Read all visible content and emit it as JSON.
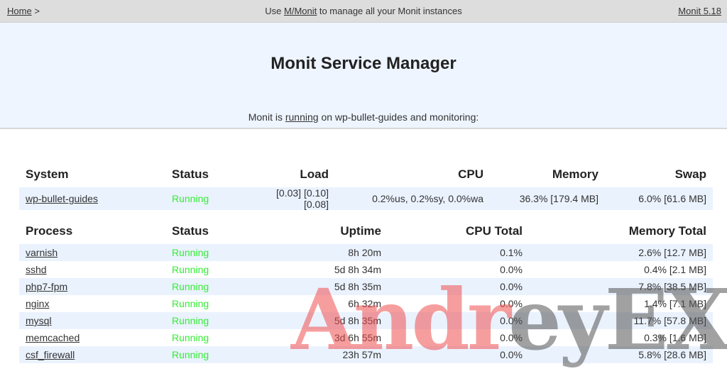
{
  "topbar": {
    "home_link": "Home",
    "home_separator": ">",
    "promo_prefix": "Use ",
    "promo_link": "M/Monit",
    "promo_suffix": " to manage all your Monit instances",
    "version_link": "Monit 5.18"
  },
  "hero": {
    "title": "Monit Service Manager",
    "subtitle_prefix": "Monit is ",
    "subtitle_link": "running",
    "subtitle_suffix": " on wp-bullet-guides and monitoring:"
  },
  "system_table": {
    "headers": [
      "System",
      "Status",
      "Load",
      "CPU",
      "Memory",
      "Swap"
    ],
    "rows": [
      {
        "name": "wp-bullet-guides",
        "status": "Running",
        "load": "[0.03] [0.10] [0.08]",
        "cpu": "0.2%us, 0.2%sy, 0.0%wa",
        "memory": "36.3% [179.4 MB]",
        "swap": "6.0% [61.6 MB]"
      }
    ]
  },
  "process_table": {
    "headers": [
      "Process",
      "Status",
      "Uptime",
      "CPU Total",
      "Memory Total"
    ],
    "rows": [
      {
        "name": "varnish",
        "status": "Running",
        "uptime": "8h 20m",
        "cpu_total": "0.1%",
        "memory_total": "2.6% [12.7 MB]"
      },
      {
        "name": "sshd",
        "status": "Running",
        "uptime": "5d 8h 34m",
        "cpu_total": "0.0%",
        "memory_total": "0.4% [2.1 MB]"
      },
      {
        "name": "php7-fpm",
        "status": "Running",
        "uptime": "5d 8h 35m",
        "cpu_total": "0.0%",
        "memory_total": "7.8% [38.5 MB]"
      },
      {
        "name": "nginx",
        "status": "Running",
        "uptime": "6h 32m",
        "cpu_total": "0.0%",
        "memory_total": "1.4% [7.1 MB]"
      },
      {
        "name": "mysql",
        "status": "Running",
        "uptime": "5d 8h 35m",
        "cpu_total": "0.0%",
        "memory_total": "11.7% [57.8 MB]"
      },
      {
        "name": "memcached",
        "status": "Running",
        "uptime": "3d 6h 55m",
        "cpu_total": "0.0%",
        "memory_total": "0.3% [1.6 MB]"
      },
      {
        "name": "csf_firewall",
        "status": "Running",
        "uptime": "23h 57m",
        "cpu_total": "0.0%",
        "memory_total": "5.8% [28.6 MB]"
      }
    ]
  },
  "watermark": {
    "part1": "Andr",
    "part2": "eyEX"
  },
  "colors": {
    "status_running": "#33ee33",
    "row_stripe": "#eaf2fe",
    "hero_bg": "#eef5ff",
    "topbar_bg": "#dddddd"
  }
}
